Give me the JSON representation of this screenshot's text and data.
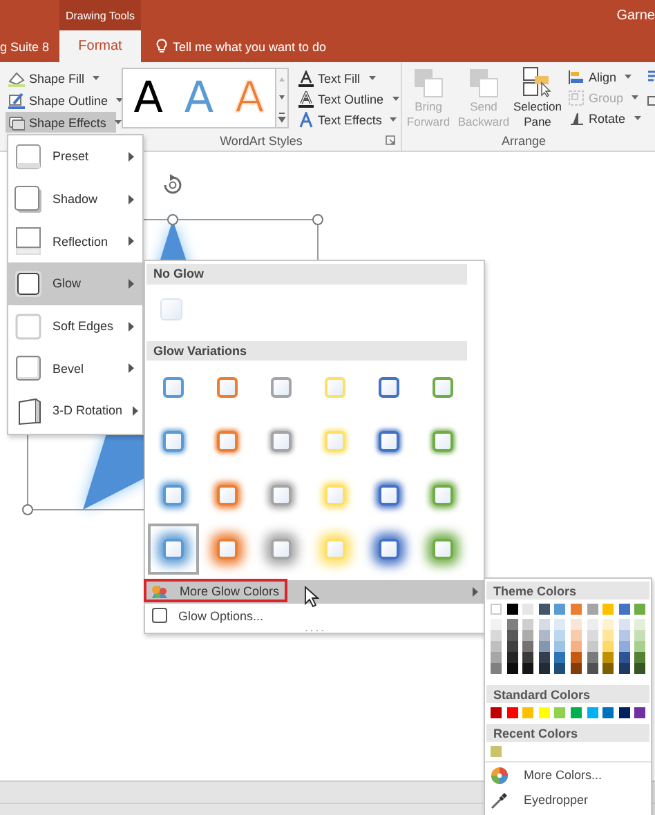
{
  "title_bar": {
    "context_label": "Drawing Tools",
    "user_name": "Garne"
  },
  "tabs": [
    {
      "label": "g Suite 8",
      "selected": false
    },
    {
      "label": "Format",
      "selected": true
    }
  ],
  "tell_me": {
    "label": "Tell me what you want to do"
  },
  "ribbon": {
    "shape_commands": [
      {
        "label": "Shape Fill",
        "pressed": false
      },
      {
        "label": "Shape Outline",
        "pressed": false
      },
      {
        "label": "Shape Effects",
        "pressed": true
      }
    ],
    "wordart_styles": {
      "label": "WordArt Styles",
      "samples": [
        {
          "text": "A",
          "color": "#000000",
          "kind": "solid"
        },
        {
          "text": "A",
          "color": "#5b9bd5",
          "kind": "solid"
        },
        {
          "text": "A",
          "color": "#ed7d31",
          "kind": "outline"
        }
      ],
      "text_commands": [
        "Text Fill",
        "Text Outline",
        "Text Effects"
      ]
    },
    "arrange": {
      "label": "Arrange",
      "buttons": [
        {
          "label": "Bring Forward",
          "disabled": true
        },
        {
          "label": "Send Backward",
          "disabled": true
        },
        {
          "label": "Selection Pane",
          "disabled": false
        }
      ],
      "commands": [
        {
          "label": "Align",
          "disabled": false
        },
        {
          "label": "Group",
          "disabled": true
        },
        {
          "label": "Rotate",
          "disabled": false
        }
      ]
    }
  },
  "effects_menu": [
    {
      "label": "Preset",
      "selected": false
    },
    {
      "label": "Shadow",
      "selected": false
    },
    {
      "label": "Reflection",
      "selected": false
    },
    {
      "label": "Glow",
      "selected": true
    },
    {
      "label": "Soft Edges",
      "selected": false
    },
    {
      "label": "Bevel",
      "selected": false
    },
    {
      "label": "3-D Rotation",
      "selected": false
    }
  ],
  "glow_menu": {
    "no_glow_header": "No Glow",
    "variations_header": "Glow Variations",
    "variation_rows": [
      [
        {
          "color": "#5b9bd5",
          "selected": false
        },
        {
          "color": "#ed7d31",
          "selected": false
        },
        {
          "color": "#a5a5a5",
          "selected": false
        },
        {
          "color": "#ffe066",
          "selected": false
        },
        {
          "color": "#4472c4",
          "selected": false
        },
        {
          "color": "#70ad47",
          "selected": false
        }
      ],
      [
        {
          "color": "#5b9bd5",
          "selected": false
        },
        {
          "color": "#ed7d31",
          "selected": false
        },
        {
          "color": "#a5a5a5",
          "selected": false
        },
        {
          "color": "#ffe066",
          "selected": false
        },
        {
          "color": "#4472c4",
          "selected": false
        },
        {
          "color": "#70ad47",
          "selected": false
        }
      ],
      [
        {
          "color": "#5b9bd5",
          "selected": false
        },
        {
          "color": "#ed7d31",
          "selected": false
        },
        {
          "color": "#a5a5a5",
          "selected": false
        },
        {
          "color": "#ffe066",
          "selected": false
        },
        {
          "color": "#4472c4",
          "selected": false
        },
        {
          "color": "#70ad47",
          "selected": false
        }
      ],
      [
        {
          "color": "#5b9bd5",
          "selected": true
        },
        {
          "color": "#ed7d31",
          "selected": false
        },
        {
          "color": "#a5a5a5",
          "selected": false
        },
        {
          "color": "#ffe066",
          "selected": false
        },
        {
          "color": "#4472c4",
          "selected": false
        },
        {
          "color": "#70ad47",
          "selected": false
        }
      ]
    ],
    "more_colors": {
      "label": "More Glow Colors",
      "highlighted": true
    },
    "options": "Glow Options..."
  },
  "color_menu": {
    "theme_header": "Theme Colors",
    "theme_columns": [
      {
        "color": "#ffffff",
        "shades": [
          {
            "color": "#f2f2f2"
          },
          {
            "color": "#d9d9d9"
          },
          {
            "color": "#bfbfbf"
          },
          {
            "color": "#a6a6a6"
          },
          {
            "color": "#808080"
          }
        ]
      },
      {
        "color": "#000000",
        "shades": [
          {
            "color": "#808080"
          },
          {
            "color": "#595959"
          },
          {
            "color": "#404040"
          },
          {
            "color": "#262626"
          },
          {
            "color": "#0d0d0d"
          }
        ]
      },
      {
        "color": "#e7e6e6",
        "shades": [
          {
            "color": "#d0cece"
          },
          {
            "color": "#aeabab"
          },
          {
            "color": "#757171"
          },
          {
            "color": "#3b3838"
          },
          {
            "color": "#171616"
          }
        ]
      },
      {
        "color": "#44546a",
        "shades": [
          {
            "color": "#d6dce4"
          },
          {
            "color": "#adb9ca"
          },
          {
            "color": "#8497b0"
          },
          {
            "color": "#333f4f"
          },
          {
            "color": "#222a35"
          }
        ]
      },
      {
        "color": "#5b9bd5",
        "shades": [
          {
            "color": "#deebf6"
          },
          {
            "color": "#bdd7ee"
          },
          {
            "color": "#9dc3e6"
          },
          {
            "color": "#2e75b5"
          },
          {
            "color": "#1f4e79"
          }
        ]
      },
      {
        "color": "#ed7d31",
        "shades": [
          {
            "color": "#fbe5d5"
          },
          {
            "color": "#f8cbad"
          },
          {
            "color": "#f4b183"
          },
          {
            "color": "#c55a11"
          },
          {
            "color": "#843c0b"
          }
        ]
      },
      {
        "color": "#a5a5a5",
        "shades": [
          {
            "color": "#ededed"
          },
          {
            "color": "#dbdbdb"
          },
          {
            "color": "#c9c9c9"
          },
          {
            "color": "#7b7b7b"
          },
          {
            "color": "#525252"
          }
        ]
      },
      {
        "color": "#ffc000",
        "shades": [
          {
            "color": "#fff2cc"
          },
          {
            "color": "#ffe699"
          },
          {
            "color": "#ffd966"
          },
          {
            "color": "#bf9000"
          },
          {
            "color": "#7f6000"
          }
        ]
      },
      {
        "color": "#4472c4",
        "shades": [
          {
            "color": "#dae3f3"
          },
          {
            "color": "#b4c7e7"
          },
          {
            "color": "#8faadc"
          },
          {
            "color": "#2f5496"
          },
          {
            "color": "#203864"
          }
        ]
      },
      {
        "color": "#70ad47",
        "shades": [
          {
            "color": "#e2efd9"
          },
          {
            "color": "#c5e0b3"
          },
          {
            "color": "#a8d08d"
          },
          {
            "color": "#538135"
          },
          {
            "color": "#375623"
          }
        ]
      }
    ],
    "standard_header": "Standard Colors",
    "standard_colors": [
      {
        "color": "#c00000"
      },
      {
        "color": "#ff0000"
      },
      {
        "color": "#ffc000"
      },
      {
        "color": "#ffff00"
      },
      {
        "color": "#92d050"
      },
      {
        "color": "#00b050"
      },
      {
        "color": "#00b0f0"
      },
      {
        "color": "#0070c0"
      },
      {
        "color": "#002060"
      },
      {
        "color": "#7030a0"
      }
    ],
    "recent_header": "Recent Colors",
    "recent_colors": [
      {
        "color": "#c9c36a"
      }
    ],
    "more_colors": "More Colors...",
    "eyedropper": "Eyedropper"
  }
}
